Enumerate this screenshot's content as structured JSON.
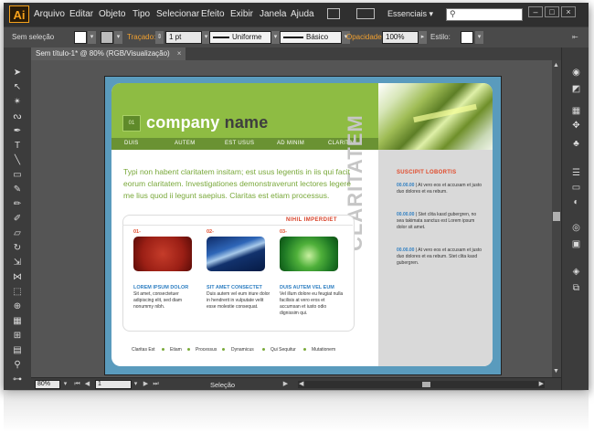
{
  "app": {
    "logo": "Ai"
  },
  "menu": [
    "Arquivo",
    "Editar",
    "Objeto",
    "Tipo",
    "Selecionar",
    "Efeito",
    "Exibir",
    "Janela",
    "Ajuda"
  ],
  "workspace": "Essenciais",
  "control_bar": {
    "selection_label": "Sem seleção",
    "stroke_label": "Traçado:",
    "stroke_weight": "1 pt",
    "profile": "Uniforme",
    "brush": "Básico",
    "opacity_label": "Opacidade:",
    "opacity_value": "100%",
    "style_label": "Estilo:"
  },
  "document_tab": {
    "title": "Sem título-1* @ 80% (RGB/Visualização)",
    "close": "×"
  },
  "status_bar": {
    "zoom": "80%",
    "page": "1",
    "tool": "Seleção"
  },
  "artwork": {
    "logo_text": "01",
    "company_word": "company",
    "name_word": "name",
    "nav": [
      "DUIS",
      "AUTEM",
      "EST USUS",
      "AD MINIM",
      "CLARITAS"
    ],
    "vertical_word": "CLARITATEM",
    "side_title": "SUSCIPIT LOBORTIS",
    "side_items": [
      {
        "date": "00.00.00",
        "text": "| At vero eos et accusam et justo duo dolores et ea rebum."
      },
      {
        "date": "00.00.00",
        "text": "| Stet clita kasd gubergren, no sea takimata sanctus est Lorem ipsum dolor sit amet."
      },
      {
        "date": "00.00.00",
        "text": "| At vero eos et accusam et justo duo dolores et ea rebum. Stet clita kasd gubergren."
      }
    ],
    "intro": "Typi non habent claritatem insitam; est usus legentis in iis qui facit eorum claritatem. Investigationes demonstraverunt lectores legere me lius quod ii legunt saepius. Claritas est etiam processus.",
    "box_title": "NIHIL IMPERDIET",
    "columns": [
      {
        "num": "01-",
        "heading": "LOREM IPSUM DOLOR",
        "text": "Sit amet, consectetuer adipiscing elit, sed diam nonummy nibh."
      },
      {
        "num": "02-",
        "heading": "SIT AMET CONSECTET",
        "text": "Duis autem vel eum iriure dolor in hendrerit in vulputate velit esse molestie consequat."
      },
      {
        "num": "03-",
        "heading": "DUIS AUTEM VEL EUM",
        "text": "Vel illum dolore eu feugiat nulla facilisis at vero eros et accumsan et iusto odio dignissim qui."
      }
    ],
    "footer": [
      "Claritas Est",
      "Etiam",
      "Processus",
      "Dynamicus",
      "Qui Sequitur",
      "Mutationem"
    ]
  },
  "colors": {
    "green": "#8ebc43",
    "nav_green": "#6a9233",
    "accent_red": "#e14a2a",
    "blue": "#2f7fc2",
    "artboard_bg": "#5a9bbd"
  }
}
